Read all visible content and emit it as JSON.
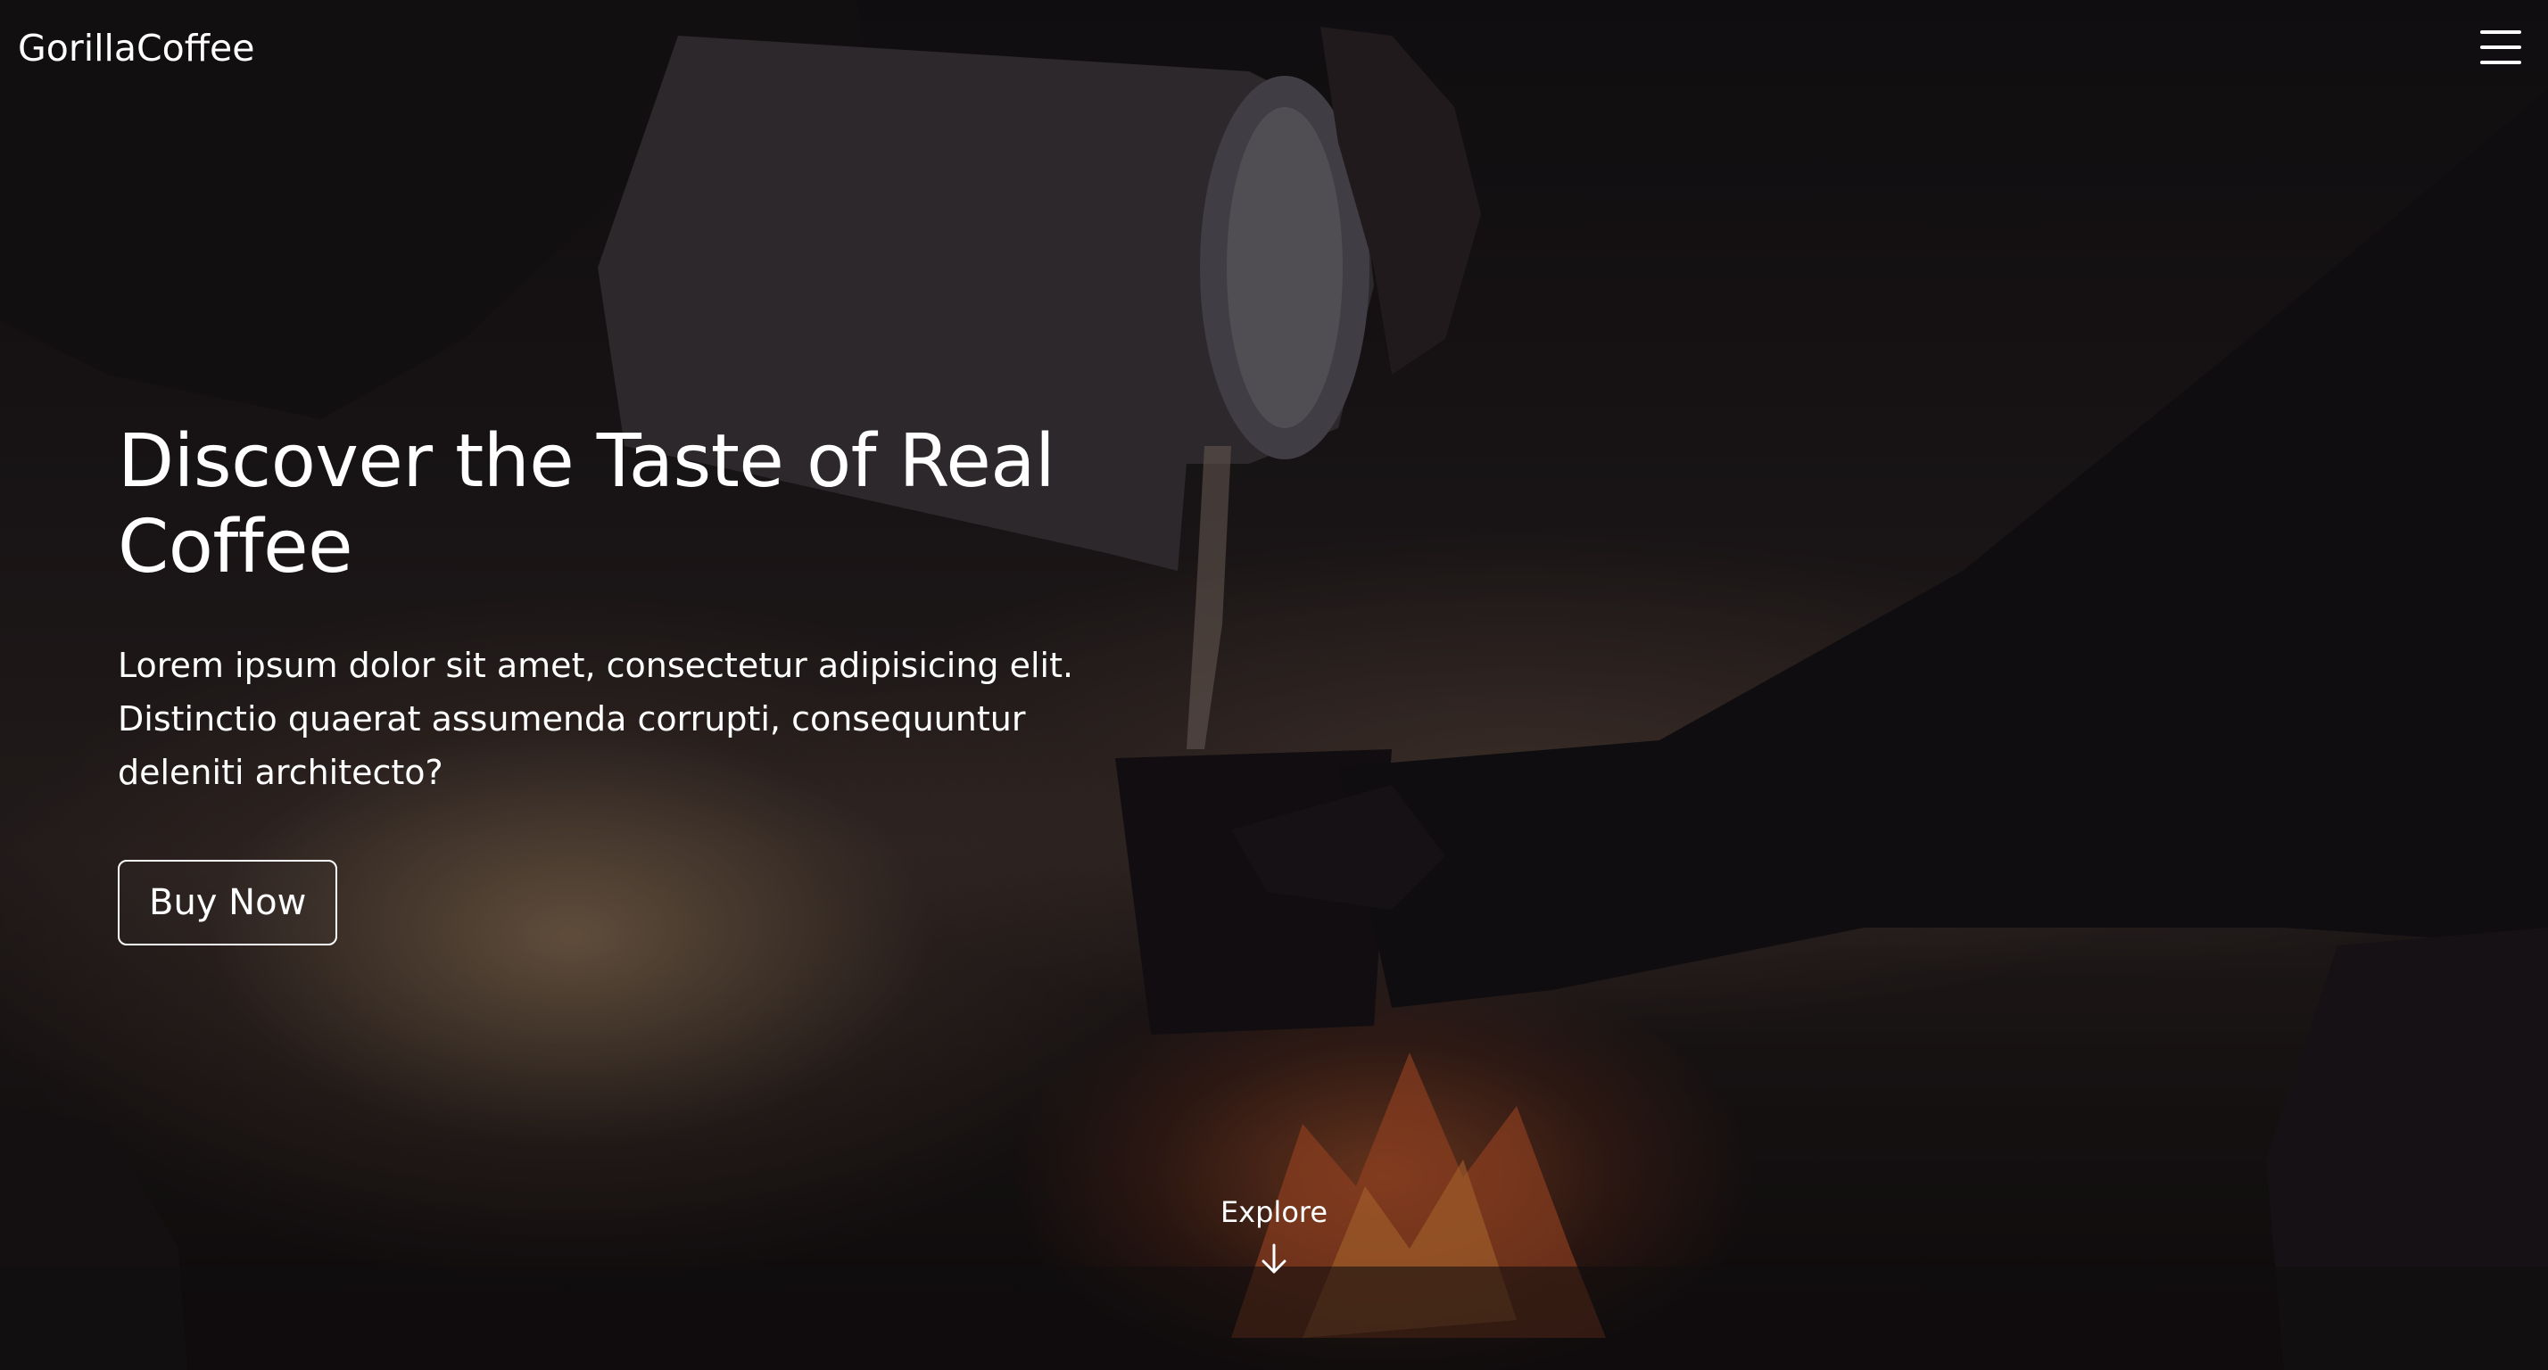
{
  "header": {
    "brand": "GorillaCoffee",
    "menu_icon": "hamburger-menu-icon"
  },
  "hero": {
    "headline": "Discover the Taste of Real Coffee",
    "subtext": "Lorem ipsum dolor sit amet, consectetur adipisicing elit. Distinctio quaerat assumenda corrupti, consequuntur deleniti architecto?",
    "cta_label": "Buy Now",
    "explore_label": "Explore",
    "explore_icon": "arrow-down-icon"
  }
}
